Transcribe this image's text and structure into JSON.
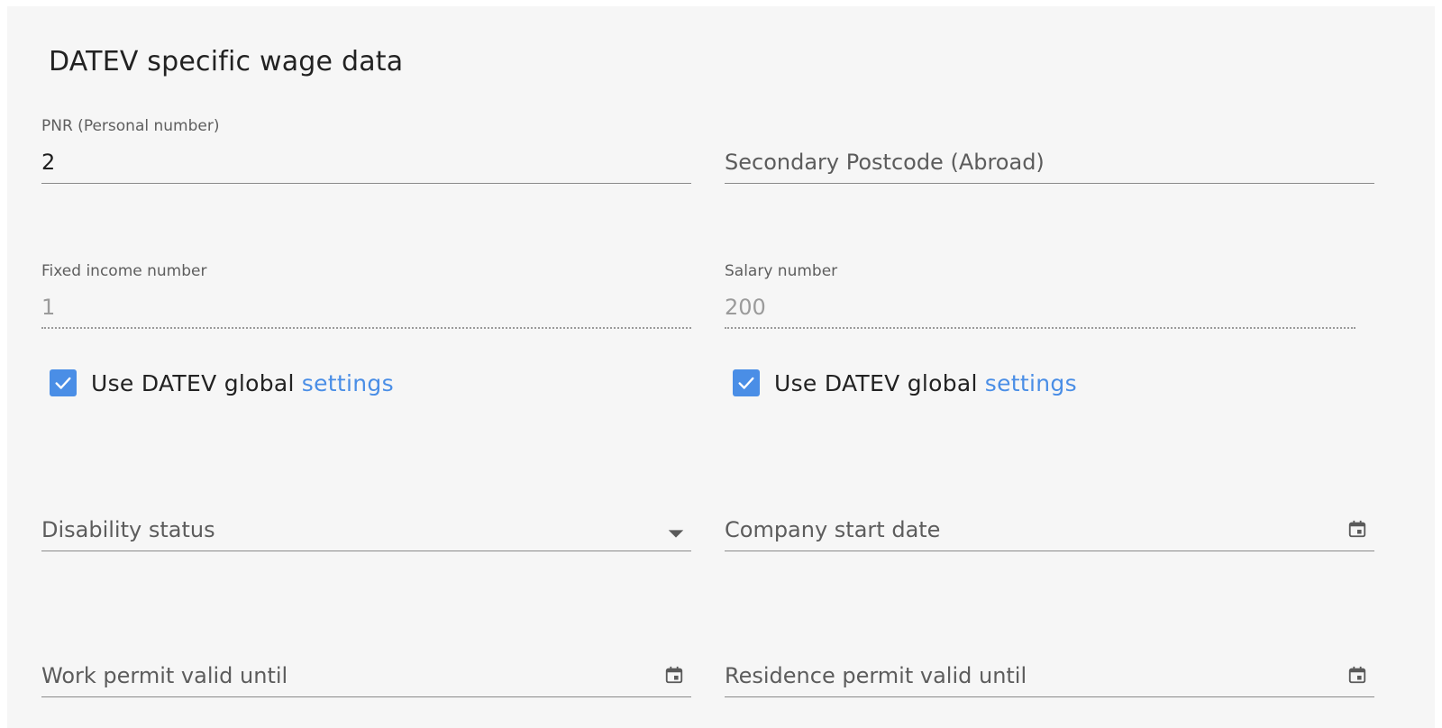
{
  "section": {
    "title": "DATEV specific wage data"
  },
  "fields": {
    "pnr": {
      "label": "PNR (Personal number)",
      "value": "2"
    },
    "secondary_postcode": {
      "placeholder": "Secondary Postcode (Abroad)"
    },
    "fixed_income": {
      "label": "Fixed income number",
      "value": "1"
    },
    "salary_number": {
      "label": "Salary number",
      "value": "200"
    },
    "disability_status": {
      "placeholder": "Disability status",
      "icon": "chevron-down-icon"
    },
    "company_start_date": {
      "placeholder": "Company start date",
      "icon": "calendar-icon"
    },
    "work_permit": {
      "placeholder": "Work permit valid until",
      "icon": "calendar-icon"
    },
    "residence_permit": {
      "placeholder": "Residence permit valid until",
      "icon": "calendar-icon"
    }
  },
  "checkboxes": {
    "fixed_income_global": {
      "checked": true,
      "text": "Use DATEV global",
      "link": "settings"
    },
    "salary_global": {
      "checked": true,
      "text": "Use DATEV global",
      "link": "settings"
    }
  },
  "colors": {
    "accent": "#4a8ee6",
    "panel_bg": "#f6f6f6",
    "disabled_text": "#9b9b9b"
  }
}
